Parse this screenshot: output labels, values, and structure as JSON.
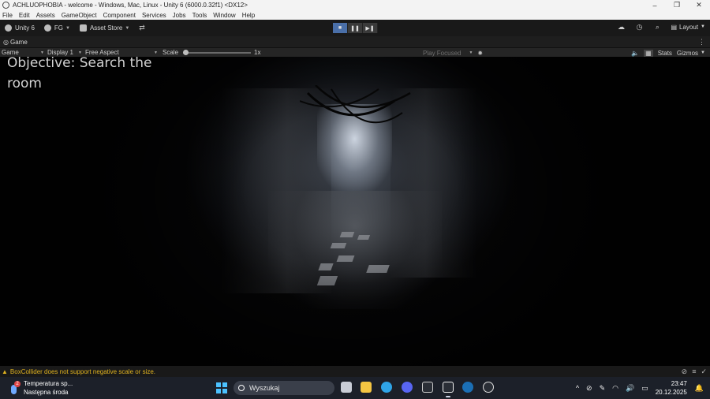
{
  "window": {
    "title": "ACHLUOPHOBIA - welcome - Windows, Mac, Linux - Unity 6 (6000.0.32f1) <DX12>",
    "controls": [
      "–",
      "❐",
      "✕"
    ]
  },
  "menu": [
    "File",
    "Edit",
    "Assets",
    "GameObject",
    "Component",
    "Services",
    "Jobs",
    "Tools",
    "Window",
    "Help"
  ],
  "toolbar": {
    "unity_label": "Unity 6",
    "account_label": "FG",
    "asset_store_label": "Asset Store",
    "layout_label": "Layout",
    "play_state": "playing"
  },
  "tabs": {
    "game_label": "Game"
  },
  "gamebar": {
    "mode": "Game",
    "display": "Display 1",
    "aspect": "Free Aspect",
    "scale_label": "Scale",
    "scale_value": "1x",
    "play_focused": "Play Focused",
    "stats": "Stats",
    "gizmos": "Gizmos"
  },
  "viewport": {
    "objective": "Objective: Search the room"
  },
  "status": {
    "warning": "BoxCollider does not support negative scale or size."
  },
  "taskbar": {
    "weather_title": "Temperatura sp...",
    "weather_sub": "Następna środa",
    "weather_badge": "2",
    "search_placeholder": "Wyszukaj",
    "time": "23:47",
    "date": "20.12.2025"
  },
  "colors": {
    "warning": "#e0b31f",
    "play_active": "#4a6fa8",
    "taskbar_bg": "#1c2029"
  }
}
